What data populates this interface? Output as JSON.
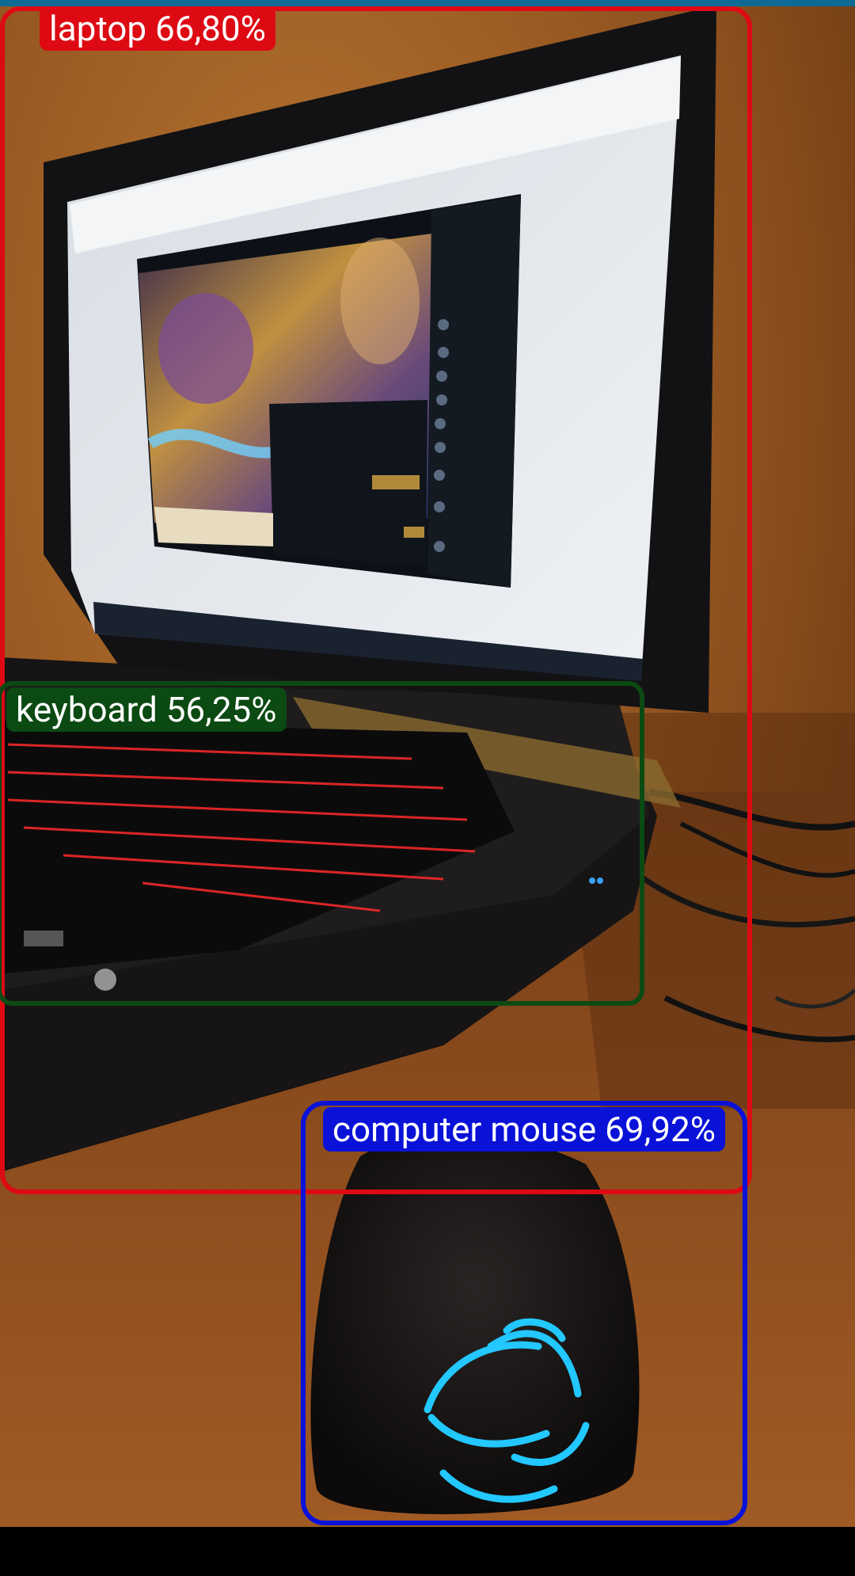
{
  "image": {
    "status_bar_color": "#0c6a94",
    "scene_colors": {
      "wall": "#9a5a22",
      "desk": "#8a4a1c",
      "laptop_body": "#1a1a1c",
      "screen": "#dfe3e8",
      "game_window": "#0d1117",
      "keyboard_glow": "#ff2a2a",
      "mouse_glow": "#22c8ff"
    }
  },
  "detections": [
    {
      "label": "laptop",
      "score": "66,80%",
      "text": "laptop 66,80%",
      "color": "#dd0a14"
    },
    {
      "label": "keyboard",
      "score": "56,25%",
      "text": "keyboard 56,25%",
      "color": "#0b4a12"
    },
    {
      "label": "computer mouse",
      "score": "69,92%",
      "text": "computer mouse 69,92%",
      "color": "#0a12d8"
    }
  ]
}
